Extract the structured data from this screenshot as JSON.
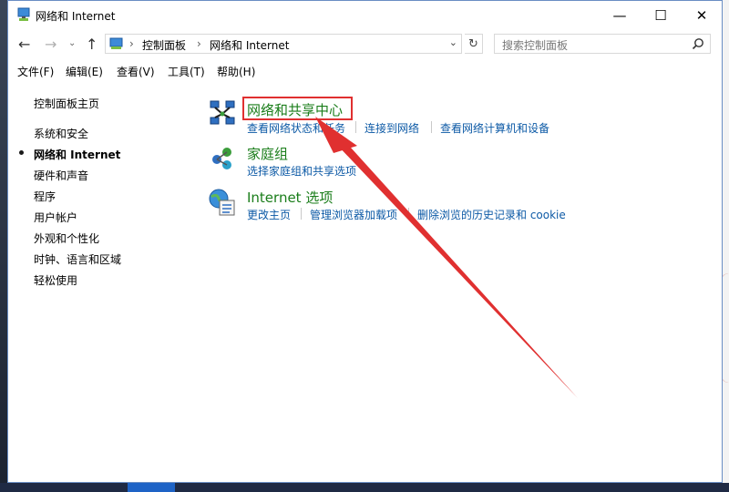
{
  "window": {
    "title": "网络和 Internet",
    "controls": {
      "minimize": "—",
      "maximize": "☐",
      "close": "✕"
    }
  },
  "navigation": {
    "back": "←",
    "forward": "→",
    "history": "⌄",
    "up": "↑"
  },
  "address": {
    "separator": "›",
    "breadcrumbs": [
      "控制面板",
      "网络和 Internet"
    ],
    "dropdown": "⌄",
    "refresh": "↻"
  },
  "search": {
    "placeholder": "搜索控制面板"
  },
  "menu": [
    "文件(F)",
    "编辑(E)",
    "查看(V)",
    "工具(T)",
    "帮助(H)"
  ],
  "sidebar": {
    "home": "控制面板主页",
    "items": [
      "系统和安全",
      "网络和 Internet",
      "硬件和声音",
      "程序",
      "用户帐户",
      "外观和个性化",
      "时钟、语言和区域",
      "轻松使用"
    ],
    "active_index": 1
  },
  "categories": [
    {
      "icon": "network-sharing-icon",
      "title": "网络和共享中心",
      "links": [
        "查看网络状态和任务",
        "连接到网络",
        "查看网络计算机和设备"
      ]
    },
    {
      "icon": "homegroup-icon",
      "title": "家庭组",
      "links": [
        "选择家庭组和共享选项"
      ]
    },
    {
      "icon": "internet-options-icon",
      "title": "Internet 选项",
      "links": [
        "更改主页",
        "管理浏览器加载项",
        "删除浏览的历史记录和 cookie"
      ]
    }
  ],
  "annotation": {
    "color": "#e03030"
  },
  "colors": {
    "heading": "#1a7d1a",
    "link": "#0d5aa6",
    "window_border": "#6a8ec4"
  }
}
